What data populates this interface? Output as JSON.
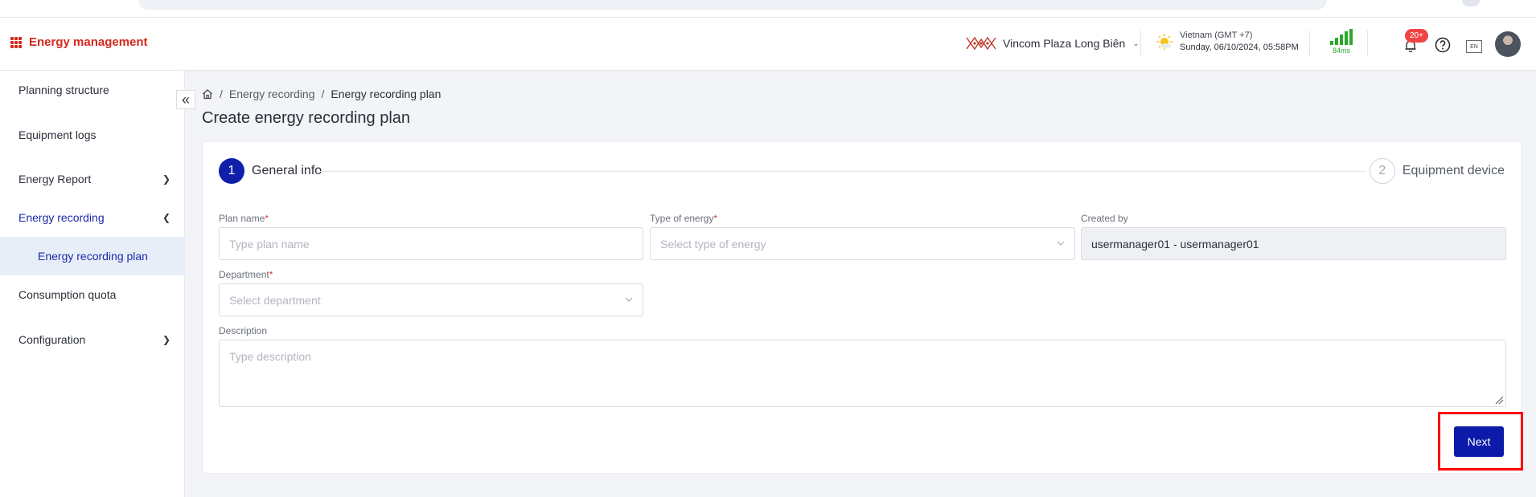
{
  "header": {
    "app_name": "Energy management",
    "location": "Vincom Plaza Long Biên",
    "timezone": "Vietnam (GMT +7)",
    "datetime": "Sunday, 06/10/2024, 05:58PM",
    "latency": "84ms",
    "notification_count": "20+",
    "language": "EN"
  },
  "sidebar": {
    "items": [
      {
        "label": "Planning structure"
      },
      {
        "label": "Equipment logs"
      },
      {
        "label": "Energy Report"
      },
      {
        "label": "Energy recording"
      },
      {
        "label": "Energy recording plan"
      },
      {
        "label": "Consumption quota"
      },
      {
        "label": "Configuration"
      }
    ]
  },
  "breadcrumb": {
    "items": [
      "Energy recording",
      "Energy recording plan"
    ],
    "separator": "/"
  },
  "page": {
    "title": "Create energy recording plan"
  },
  "steps": [
    {
      "number": "1",
      "label": "General info"
    },
    {
      "number": "2",
      "label": "Equipment device"
    }
  ],
  "form": {
    "plan_name": {
      "label": "Plan name",
      "required": "*",
      "placeholder": "Type plan name"
    },
    "energy_type": {
      "label": "Type of energy",
      "required": "*",
      "placeholder": "Select type of energy"
    },
    "created_by": {
      "label": "Created by",
      "value": "usermanager01 - usermanager01"
    },
    "department": {
      "label": "Department",
      "required": "*",
      "placeholder": "Select department"
    },
    "description": {
      "label": "Description",
      "placeholder": "Type description"
    }
  },
  "actions": {
    "next_label": "Next"
  },
  "colors": {
    "brand": "#d4281d",
    "primary": "#0b1aa8",
    "highlight": "#ff0000"
  }
}
